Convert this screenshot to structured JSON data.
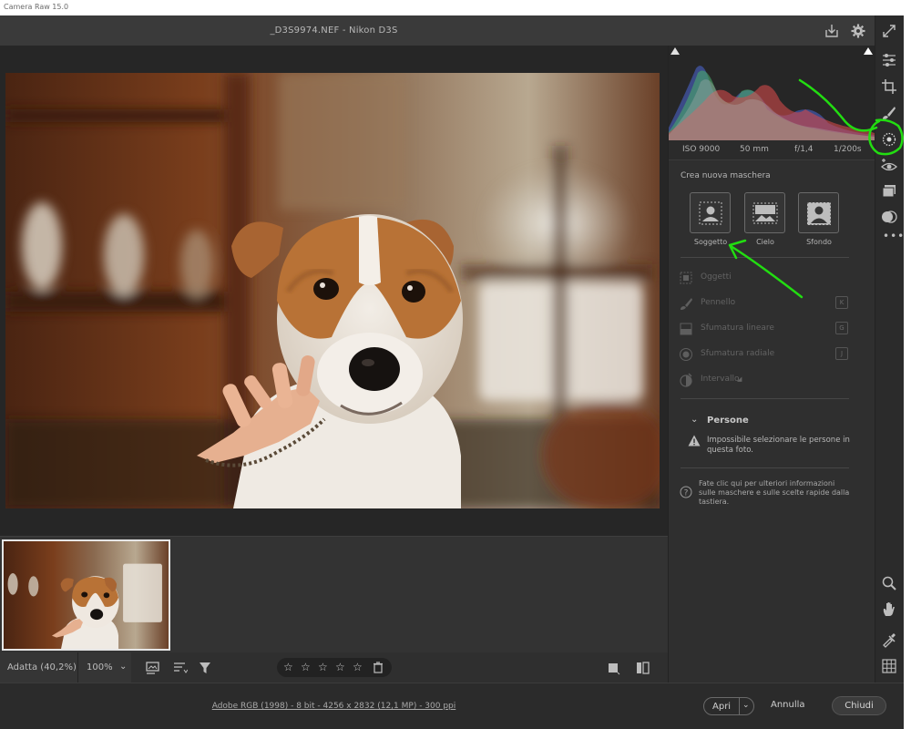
{
  "window": {
    "title": "Camera Raw 15.0"
  },
  "header": {
    "file_title": "_D3S9974.NEF  -  Nikon D3S"
  },
  "exif": {
    "iso": "ISO 9000",
    "focal": "50 mm",
    "aperture": "f/1,4",
    "shutter": "1/200s"
  },
  "masks": {
    "title": "Crea nuova maschera",
    "buttons": [
      {
        "label": "Soggetto"
      },
      {
        "label": "Cielo"
      },
      {
        "label": "Sfondo"
      }
    ],
    "tools": [
      {
        "label": "Oggetti",
        "key": ""
      },
      {
        "label": "Pennello",
        "key": "K"
      },
      {
        "label": "Sfumatura lineare",
        "key": "G"
      },
      {
        "label": "Sfumatura radiale",
        "key": "J"
      },
      {
        "label": "Intervallo",
        "key": ""
      }
    ],
    "people": {
      "title": "Persone",
      "warning": "Impossibile selezionare le persone in questa foto."
    },
    "help": "Fate clic qui per ulteriori informazioni sulle maschere e sulle scelte rapide dalla tastiera."
  },
  "bottom": {
    "zoom_fit": "Adatta (40,2%)",
    "zoom_value": "100%",
    "rating_stars": 5
  },
  "footer": {
    "info": "Adobe RGB (1998) - 8 bit - 4256 x 2832 (12,1 MP) - 300 ppi",
    "open": "Apri",
    "cancel": "Annulla",
    "close": "Chiudi"
  },
  "colors": {
    "annotation": "#22dd11",
    "panel_bg": "#2f2f2f",
    "histogram_red": "#d24a4a",
    "histogram_green": "#4aa86a",
    "histogram_blue": "#4a62c8"
  }
}
